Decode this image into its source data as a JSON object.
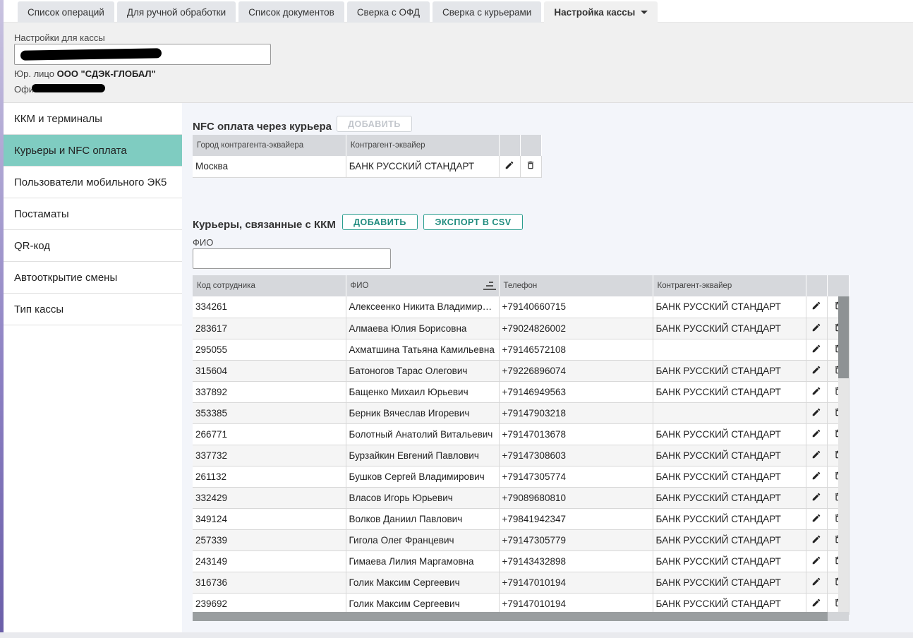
{
  "tabs": [
    {
      "label": "Список операций"
    },
    {
      "label": "Для ручной обработки"
    },
    {
      "label": "Список документов"
    },
    {
      "label": "Сверка с ОФД"
    },
    {
      "label": "Сверка с курьерами"
    },
    {
      "label": "Настройка кассы"
    }
  ],
  "header": {
    "settings_label": "Настройки для кассы",
    "legal_prefix": "Юр. лицо",
    "legal_value": "ООО \"СДЭК-ГЛОБАЛ\"",
    "office_prefix": "Офис"
  },
  "sidebar": {
    "items": [
      {
        "label": "ККМ и терминалы"
      },
      {
        "label": "Курьеры и NFC оплата"
      },
      {
        "label": "Пользователи мобильного ЭК5"
      },
      {
        "label": "Постаматы"
      },
      {
        "label": "QR-код"
      },
      {
        "label": "Автооткрытие смены"
      },
      {
        "label": "Тип кассы"
      }
    ]
  },
  "nfc": {
    "title": "NFC оплата через курьера",
    "add_label": "ДОБАВИТЬ",
    "columns": [
      "Город контрагента-эквайера",
      "Контрагент-эквайер"
    ],
    "rows": [
      {
        "city": "Москва",
        "acquirer": "БАНК РУССКИЙ СТАНДАРТ"
      }
    ]
  },
  "couriers": {
    "title": "Курьеры, связанные с ККМ",
    "add_label": "ДОБАВИТЬ",
    "export_label": "ЭКСПОРТ В CSV",
    "filter_label": "ФИО",
    "filter_value": "",
    "columns": [
      "Код сотрудника",
      "ФИО",
      "Телефон",
      "Контрагент-эквайер"
    ],
    "rows": [
      {
        "code": "334261",
        "name": "Алексеенко Никита Владимирович",
        "phone": "+79140660715",
        "acquirer": "БАНК РУССКИЙ СТАНДАРТ"
      },
      {
        "code": "283617",
        "name": "Алмаева Юлия Борисовна",
        "phone": "+79024826002",
        "acquirer": "БАНК РУССКИЙ СТАНДАРТ"
      },
      {
        "code": "295055",
        "name": "Ахматшина Татьяна Камильевна",
        "phone": "+79146572108",
        "acquirer": ""
      },
      {
        "code": "315604",
        "name": "Батоногов Тарас Олегович",
        "phone": "+79226896074",
        "acquirer": "БАНК РУССКИЙ СТАНДАРТ"
      },
      {
        "code": "337892",
        "name": "Бащенко Михаил Юрьевич",
        "phone": "+79146949563",
        "acquirer": "БАНК РУССКИЙ СТАНДАРТ"
      },
      {
        "code": "353385",
        "name": "Берник Вячеслав Игоревич",
        "phone": "+79147903218",
        "acquirer": ""
      },
      {
        "code": "266771",
        "name": "Болотный Анатолий Витальевич",
        "phone": "+79147013678",
        "acquirer": "БАНК РУССКИЙ СТАНДАРТ"
      },
      {
        "code": "337732",
        "name": "Бурзайкин Евгений Павлович",
        "phone": "+79147308603",
        "acquirer": "БАНК РУССКИЙ СТАНДАРТ"
      },
      {
        "code": "261132",
        "name": "Бушков Сергей Владимирович",
        "phone": "+79147305774",
        "acquirer": "БАНК РУССКИЙ СТАНДАРТ"
      },
      {
        "code": "332429",
        "name": "Власов Игорь Юрьевич",
        "phone": "+79089680810",
        "acquirer": "БАНК РУССКИЙ СТАНДАРТ"
      },
      {
        "code": "349124",
        "name": "Волков Даниил Павлович",
        "phone": "+79841942347",
        "acquirer": "БАНК РУССКИЙ СТАНДАРТ"
      },
      {
        "code": "257339",
        "name": "Гигола Олег Францевич",
        "phone": "+79147305779",
        "acquirer": "БАНК РУССКИЙ СТАНДАРТ"
      },
      {
        "code": "243149",
        "name": "Гимаева Лилия Маргамовна",
        "phone": "+79143432898",
        "acquirer": "БАНК РУССКИЙ СТАНДАРТ"
      },
      {
        "code": "316736",
        "name": "Голик Максим Сергеевич",
        "phone": "+79147010194",
        "acquirer": "БАНК РУССКИЙ СТАНДАРТ"
      },
      {
        "code": "239692",
        "name": "Голик Максим Сергеевич",
        "phone": "+79147010194",
        "acquirer": "БАНК РУССКИЙ СТАНДАРТ"
      }
    ]
  },
  "colors": {
    "accent": "#7fccc1",
    "button_border": "#2a9d8f",
    "header_bg": "#f0f0f0"
  },
  "icons": {
    "edit": "pencil-icon",
    "delete": "trash-icon",
    "sort": "sort-icon",
    "dropdown": "caret-down-icon"
  }
}
